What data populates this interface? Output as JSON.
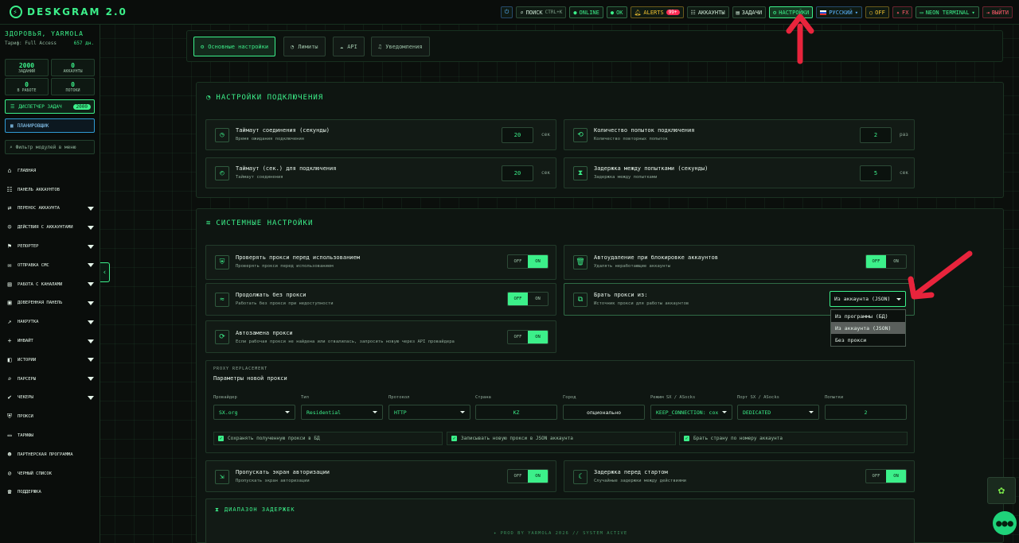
{
  "app": {
    "title": "DESKGRAM 2.0",
    "logo_icon": "logo-icon"
  },
  "topbar": {
    "power_icon": "⏻",
    "search": {
      "label": "ПОИСК",
      "shortcut": "CTRL+K"
    },
    "online": "ONLINE",
    "ok": "OK",
    "alerts": {
      "label": "ALERTS",
      "count": "99+"
    },
    "accounts": "АККАУНТЫ",
    "tasks": "ЗАДАЧИ",
    "settings": "НАСТРОЙКИ",
    "language": "РУССКИЙ",
    "off": "OFF",
    "fx": "FX",
    "theme": "NEON TERMINAL",
    "logout": "ВЫЙТИ"
  },
  "sidebar": {
    "user": "ЗДОРОВЬЯ, YARMOLA",
    "plan": "Тариф: Full Access",
    "days": "657 дн.",
    "stats": [
      {
        "value": "2000",
        "label": "ЗАДАНИЙ"
      },
      {
        "value": "0",
        "label": "АККАУНТЫ"
      },
      {
        "value": "0",
        "label": "В РАБОТЕ"
      },
      {
        "value": "0",
        "label": "ПОТОКИ"
      }
    ],
    "dispatcher": {
      "label": "ДИСПЕТЧЕР ЗАДАЧ",
      "count": "2000"
    },
    "scheduler": "ПЛАНИРОВЩИК",
    "filter_placeholder": "Фильтр модулей в меню",
    "nav": [
      {
        "label": "ГЛАВНАЯ",
        "icon": "home-icon",
        "glyph": "⌂",
        "has_children": false
      },
      {
        "label": "ПАНЕЛЬ АККАУНТОВ",
        "icon": "users-icon",
        "glyph": "☷",
        "has_children": false
      },
      {
        "label": "ПЕРЕНОС АККАУНТА",
        "icon": "transfer-icon",
        "glyph": "⇄",
        "has_children": true
      },
      {
        "label": "ДЕЙСТВИЯ С АККАУНТАМИ",
        "icon": "user-actions-icon",
        "glyph": "☺",
        "has_children": true
      },
      {
        "label": "РЕПОРТЕР",
        "icon": "flag-icon",
        "glyph": "⚑",
        "has_children": true
      },
      {
        "label": "ОТПРАВКА СМС",
        "icon": "message-icon",
        "glyph": "✉",
        "has_children": true
      },
      {
        "label": "РАБОТА С КАНАЛАМИ",
        "icon": "channels-icon",
        "glyph": "▤",
        "has_children": true
      },
      {
        "label": "ДОВЕРЕННАЯ ПАНЕЛЬ",
        "icon": "panel-icon",
        "glyph": "▣",
        "has_children": true
      },
      {
        "label": "НАКРУТКА",
        "icon": "chart-icon",
        "glyph": "↗",
        "has_children": true
      },
      {
        "label": "ИНВАЙТ",
        "icon": "invite-icon",
        "glyph": "+",
        "has_children": true
      },
      {
        "label": "ИСТОРИИ",
        "icon": "stories-icon",
        "glyph": "◧",
        "has_children": true
      },
      {
        "label": "ПАРСЕРЫ",
        "icon": "search-icon",
        "glyph": "⌕",
        "has_children": true
      },
      {
        "label": "ЧЕКЕРЫ",
        "icon": "check-icon",
        "glyph": "✔",
        "has_children": true
      },
      {
        "label": "ПРОКСИ",
        "icon": "shield-icon",
        "glyph": "⛨",
        "has_children": false
      },
      {
        "label": "ТАРИФЫ",
        "icon": "card-icon",
        "glyph": "▭",
        "has_children": false
      },
      {
        "label": "ПАРТНЕРСКАЯ ПРОГРАММА",
        "icon": "partner-icon",
        "glyph": "☻",
        "has_children": false
      },
      {
        "label": "ЧЕРНЫЙ СПИСОК",
        "icon": "blacklist-icon",
        "glyph": "⊘",
        "has_children": false
      },
      {
        "label": "ПОДДЕРЖКА",
        "icon": "headset-icon",
        "glyph": "☎",
        "has_children": false
      }
    ]
  },
  "tabs": [
    {
      "label": "Основные настройки",
      "icon": "gear-icon",
      "glyph": "⚙"
    },
    {
      "label": "Лимиты",
      "icon": "gauge-icon",
      "glyph": "◔"
    },
    {
      "label": "API",
      "icon": "cloud-icon",
      "glyph": "☁"
    },
    {
      "label": "Уведомления",
      "icon": "bell-icon",
      "glyph": "♫"
    }
  ],
  "connection": {
    "title": "НАСТРОЙКИ ПОДКЛЮЧЕНИЯ",
    "items": [
      {
        "title": "Таймаут соединения (секунды)",
        "sub": "Время ожидания подключения",
        "value": "20",
        "unit": "сек",
        "icon": "clock-icon",
        "glyph": "◷"
      },
      {
        "title": "Количество попыток подключения",
        "sub": "Количество повторных попыток",
        "value": "2",
        "unit": "раз",
        "icon": "retry-icon",
        "glyph": "⟲"
      },
      {
        "title": "Таймаут (сек.) для подключения",
        "sub": "Таймаут соединения",
        "value": "20",
        "unit": "сек",
        "icon": "stopwatch-icon",
        "glyph": "◴"
      },
      {
        "title": "Задержка между попытками (секунды)",
        "sub": "Задержка между попытками",
        "value": "5",
        "unit": "сек",
        "icon": "hourglass-icon",
        "glyph": "⧗"
      }
    ]
  },
  "system": {
    "title": "СИСТЕМНЫЕ НАСТРОЙКИ",
    "off": "OFF",
    "on": "ON",
    "check_proxy": {
      "title": "Проверять прокси перед использованием",
      "sub": "Проверять прокси перед использованием",
      "state": "on"
    },
    "auto_delete": {
      "title": "Автоудаление при блокировке аккаунтов",
      "sub": "Удалять неработающие аккаунты",
      "state": "off"
    },
    "no_proxy": {
      "title": "Продолжать без прокси",
      "sub": "Работать без прокси при недоступности",
      "state": "off"
    },
    "proxy_source": {
      "title": "Брать прокси из:",
      "sub": "Источник прокси для работы аккаунтов",
      "value": "Из аккаунта (JSON)",
      "options": [
        "Из программы (БД)",
        "Из аккаунта (JSON)",
        "Без прокси"
      ],
      "selected_index": 1
    },
    "auto_replace": {
      "title": "Автозамена прокси",
      "sub": "Если рабочая прокси не найдена или отвалилась, запросить новую через API провайдера",
      "state": "on"
    }
  },
  "replacement": {
    "caption": "PROXY REPLACEMENT",
    "title": "Параметры новой прокси",
    "fields": [
      {
        "label": "Провайдер",
        "value": "SX.org",
        "kind": "select"
      },
      {
        "label": "Тип",
        "value": "Residential",
        "kind": "select"
      },
      {
        "label": "Протокол",
        "value": "HTTP",
        "kind": "select"
      },
      {
        "label": "Страна",
        "value": "KZ",
        "kind": "input"
      },
      {
        "label": "Город",
        "value": "опционально",
        "kind": "placeholder"
      },
      {
        "label": "Режим SX / ASocks",
        "value": "KEEP_CONNECTION: cox",
        "kind": "select"
      },
      {
        "label": "Порт SX / ASocks",
        "value": "DEDICATED",
        "kind": "select"
      },
      {
        "label": "Попытки",
        "value": "2",
        "kind": "input"
      }
    ],
    "checks": [
      "Сохранять полученную прокси в БД",
      "Записывать новую прокси в JSON аккаунта",
      "Брать страну по номеру аккаунта"
    ]
  },
  "misc": {
    "skip_auth": {
      "title": "Пропускать экран авторизации",
      "sub": "Пропускать экран авторизации",
      "state": "on"
    },
    "start_delay": {
      "title": "Задержка перед стартом",
      "sub": "Случайные задержки между действиями",
      "state": "on"
    },
    "delay_range": "ДИАПАЗОН ЗАДЕРЖЕК"
  },
  "footer": "✦ PROD BY YARMOLA 2026  // SYSTEM ACTIVE",
  "colors": {
    "accent": "#3cf08a",
    "annotation": "#e8243c",
    "background": "#0b0f0c"
  }
}
